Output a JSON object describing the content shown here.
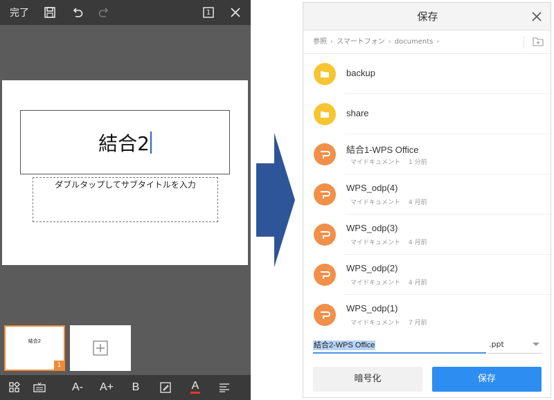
{
  "editor": {
    "done_label": "完了",
    "page_indicator": "1",
    "slide_title": "結合2",
    "subtitle_placeholder": "ダブルタップしてサブタイトルを入力",
    "thumbnail_title": "結合2",
    "thumbnail_number": "1",
    "format_bar": {
      "font_decrease": "A-",
      "font_increase": "A+",
      "bold": "B",
      "font_color": "A"
    },
    "accent_color": "#f08a35"
  },
  "dialog": {
    "title": "保存",
    "breadcrumb": [
      "参照",
      "スマートフォン",
      "documents"
    ],
    "files": [
      {
        "name": "backup",
        "type": "folder"
      },
      {
        "name": "share",
        "type": "folder"
      },
      {
        "name": "結合1-WPS Office",
        "type": "presentation",
        "location": "マイドキュメント",
        "age": "1 分前"
      },
      {
        "name": "WPS_odp(4)",
        "type": "presentation",
        "location": "マイドキュメント",
        "age": "4 月前"
      },
      {
        "name": "WPS_odp(3)",
        "type": "presentation",
        "location": "マイドキュメント",
        "age": "4 月前"
      },
      {
        "name": "WPS_odp(2)",
        "type": "presentation",
        "location": "マイドキュメント",
        "age": "4 月前"
      },
      {
        "name": "WPS_odp(1)",
        "type": "presentation",
        "location": "マイドキュメント",
        "age": "7 月前"
      }
    ],
    "filename_value": "結合2-WPS Office",
    "extension_value": ".ppt",
    "encrypt_label": "暗号化",
    "save_label": "保存",
    "colors": {
      "save_button": "#2e8df0",
      "folder_icon": "#f7c531",
      "presentation_icon": "#f19049"
    }
  }
}
